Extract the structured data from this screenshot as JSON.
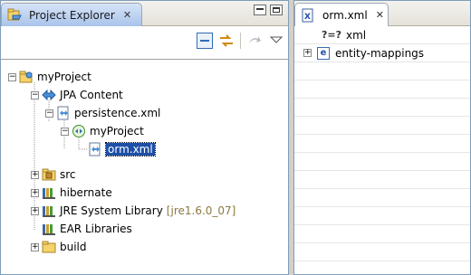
{
  "project_explorer": {
    "tab_title": "Project Explorer",
    "tree": [
      {
        "label": "myProject",
        "depth": 0,
        "expander": "−",
        "icon": "project-icon"
      },
      {
        "label": "JPA Content",
        "depth": 1,
        "expander": "−",
        "icon": "jpa-content-icon"
      },
      {
        "label": "persistence.xml",
        "depth": 2,
        "expander": "−",
        "icon": "persistence-xml-icon"
      },
      {
        "label": "myProject",
        "depth": 3,
        "expander": "−",
        "icon": "persistence-unit-icon"
      },
      {
        "label": "orm.xml",
        "depth": 4,
        "expander": "",
        "icon": "orm-xml-icon",
        "selected": true
      },
      {
        "label": "src",
        "depth": 1,
        "expander": "+",
        "icon": "source-folder-icon"
      },
      {
        "label": "hibernate",
        "depth": 1,
        "expander": "+",
        "icon": "library-icon"
      },
      {
        "label": "JRE System Library",
        "suffix": "[jre1.6.0_07]",
        "depth": 1,
        "expander": "+",
        "icon": "library-icon"
      },
      {
        "label": "EAR Libraries",
        "depth": 1,
        "expander": "",
        "icon": "library-icon"
      },
      {
        "label": "build",
        "depth": 1,
        "expander": "+",
        "icon": "folder-icon"
      }
    ]
  },
  "editor": {
    "tab_title": "orm.xml",
    "rows": [
      {
        "prefix": "?=?",
        "label": "xml",
        "expander": ""
      },
      {
        "prefix": "e",
        "label": "entity-mappings",
        "expander": "+"
      }
    ]
  },
  "colors": {
    "selection": "#1d4fa8",
    "active_tab": "#a9c3ea",
    "border": "#7f9db9"
  }
}
